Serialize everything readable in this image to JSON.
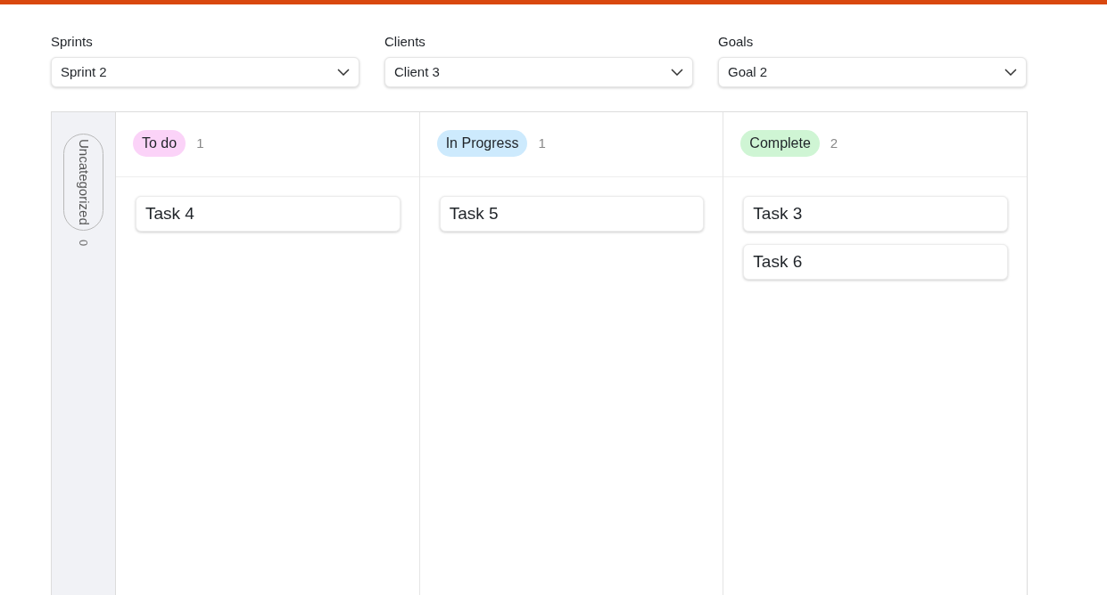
{
  "filters": [
    {
      "label": "Sprints",
      "value": "Sprint 2"
    },
    {
      "label": "Clients",
      "value": "Client 3"
    },
    {
      "label": "Goals",
      "value": "Goal 2"
    }
  ],
  "uncategorized": {
    "label": "Uncategorized",
    "count": "0"
  },
  "columns": [
    {
      "title": "To do",
      "count": "1",
      "color": "#fbd3f8",
      "cards": [
        "Task 4"
      ]
    },
    {
      "title": "In Progress",
      "count": "1",
      "color": "#cdeafd",
      "cards": [
        "Task 5"
      ]
    },
    {
      "title": "Complete",
      "count": "2",
      "color": "#cff5d4",
      "cards": [
        "Task 3",
        "Task 6"
      ]
    }
  ]
}
